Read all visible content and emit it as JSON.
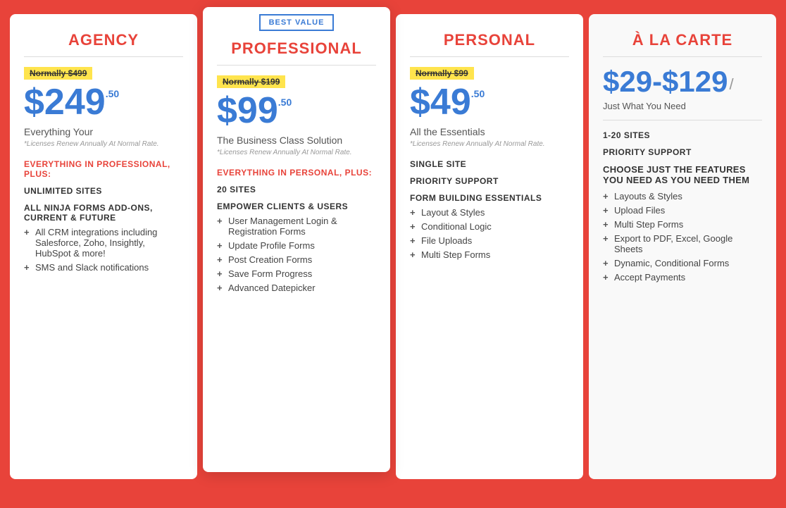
{
  "plans": [
    {
      "id": "agency",
      "title": "AGENCY",
      "featured": false,
      "normally": "Normally $499",
      "price": "$249",
      "price_super": ".50",
      "subtitle": "Everything Your",
      "renewal": "*Licenses Renew Annually At Normal Rate.",
      "section_label": "EVERYTHING IN PROFESSIONAL, PLUS:",
      "features_bold": [
        "UNLIMITED SITES",
        "ALL NINJA FORMS ADD-ONS, CURRENT & FUTURE"
      ],
      "features": [
        "All CRM integrations including Salesforce, Zoho, Insightly, HubSpot & more!",
        "SMS and Slack notifications"
      ]
    },
    {
      "id": "professional",
      "title": "PROFESSIONAL",
      "featured": true,
      "best_value_label": "BEST VALUE",
      "normally": "Normally $199",
      "price": "$99",
      "price_super": ".50",
      "subtitle": "The Business Class Solution",
      "renewal": "*Licenses Renew Annually At Normal Rate.",
      "section_label": "EVERYTHING IN PERSONAL, PLUS:",
      "features_bold": [
        "20 SITES",
        "EMPOWER CLIENTS & USERS"
      ],
      "features": [
        "User Management Login & Registration Forms",
        "Update Profile Forms",
        "Post Creation Forms",
        "Save Form Progress",
        "Advanced Datepicker"
      ]
    },
    {
      "id": "personal",
      "title": "PERSONAL",
      "featured": false,
      "normally": "Normally $99",
      "price": "$49",
      "price_super": ".50",
      "subtitle": "All the Essentials",
      "renewal": "*Licenses Renew Annually At Normal Rate.",
      "features_section": "FORM BUILDING ESSENTIALS",
      "meta_features": [
        "SINGLE SITE",
        "PRIORITY SUPPORT"
      ],
      "features": [
        "Layout & Styles",
        "Conditional Logic",
        "File Uploads",
        "Multi Step Forms"
      ]
    },
    {
      "id": "alacarte",
      "title": "À LA CARTE",
      "featured": false,
      "price_range": "$29-$129",
      "price_slash": "/",
      "subtitle": "Just What You Need",
      "meta_features": [
        "1-20 SITES",
        "PRIORITY SUPPORT"
      ],
      "alacarte_label": "CHOOSE JUST THE FEATURES YOU NEED AS YOU NEED THEM",
      "features": [
        "Layouts & Styles",
        "Upload Files",
        "Multi Step Forms",
        "Export to PDF, Excel, Google Sheets",
        "Dynamic, Conditional Forms",
        "Accept Payments"
      ]
    }
  ]
}
